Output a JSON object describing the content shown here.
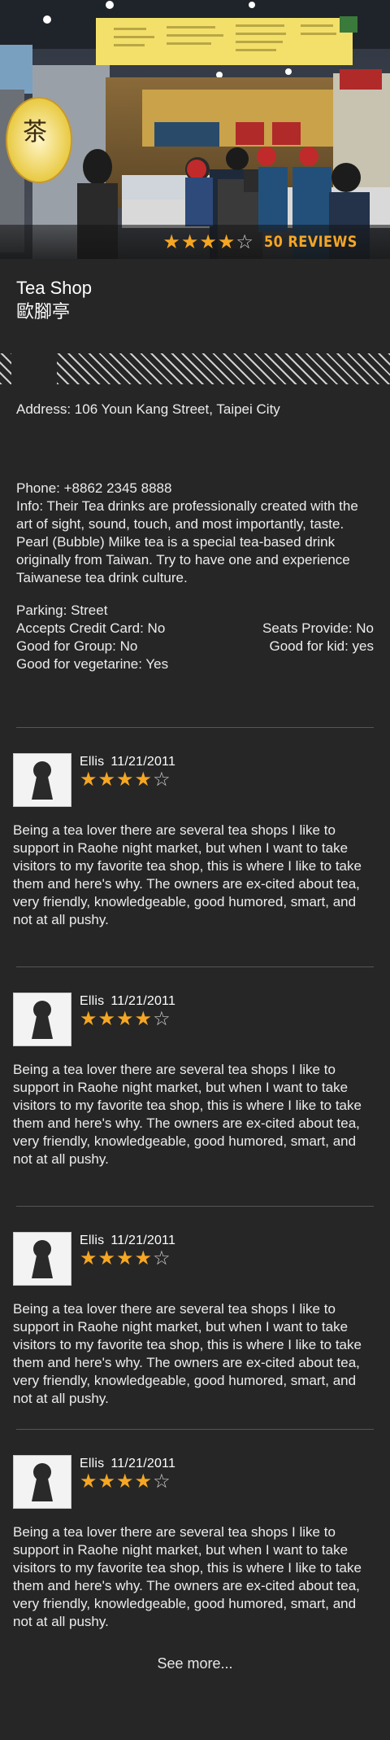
{
  "hero": {
    "store_sign": "茶",
    "rating": 4,
    "max_rating": 5,
    "reviews_label": "50 REVIEWS"
  },
  "shop": {
    "name": "Tea Shop",
    "subtitle": "歐腳亭"
  },
  "details": {
    "address": "Address: 106 Youn Kang Street, Taipei City",
    "phone": "Phone: +8862 2345 8888",
    "info": "Info: Their Tea drinks are professionally created with the art of sight, sound, touch, and most importantly, taste. Pearl (Bubble) Milke tea is a special tea-based drink originally from Taiwan. Try to have one and experience Taiwanese tea drink culture.",
    "parking": "Parking: Street",
    "credit_card": "Accepts Credit Card: No",
    "seats": "Seats Provide: No",
    "group": "Good for Group: No",
    "kid": "Good for kid: yes",
    "vegetarian": "Good for vegetarine: Yes"
  },
  "reviews": [
    {
      "name": "Ellis",
      "date": "11/21/2011",
      "rating": 4,
      "text": "Being a tea lover there are several tea shops I like to support in Raohe night market, but when I want to take visitors to my favorite tea shop, this is where I like to take them and here's why. The owners are ex-cited about tea, very friendly, knowledgeable, good humored, smart, and not at all pushy."
    },
    {
      "name": "Ellis",
      "date": "11/21/2011",
      "rating": 4,
      "text": "Being a tea lover there are several tea shops I like to support in Raohe night market, but when I want to take visitors to my favorite tea shop, this is where I like to take them and here's why. The owners are ex-cited about tea, very friendly, knowledgeable, good humored, smart, and not at all pushy."
    },
    {
      "name": "Ellis",
      "date": "11/21/2011",
      "rating": 4,
      "text": "Being a tea lover there are several tea shops I like to support in Raohe night market, but when I want to take visitors to my favorite tea shop, this is where I like to take them and here's why. The owners are ex-cited about tea, very friendly, knowledgeable, good humored, smart, and not at all pushy."
    },
    {
      "name": "Ellis",
      "date": "11/21/2011",
      "rating": 4,
      "text": "Being a tea lover there are several tea shops I like to support in Raohe night market, but when I want to take visitors to my favorite tea shop, this is where I like to take them and here's why. The owners are ex-cited about tea, very friendly, knowledgeable, good humored, smart, and not at all pushy."
    }
  ],
  "footer": {
    "see_more": "See more..."
  }
}
